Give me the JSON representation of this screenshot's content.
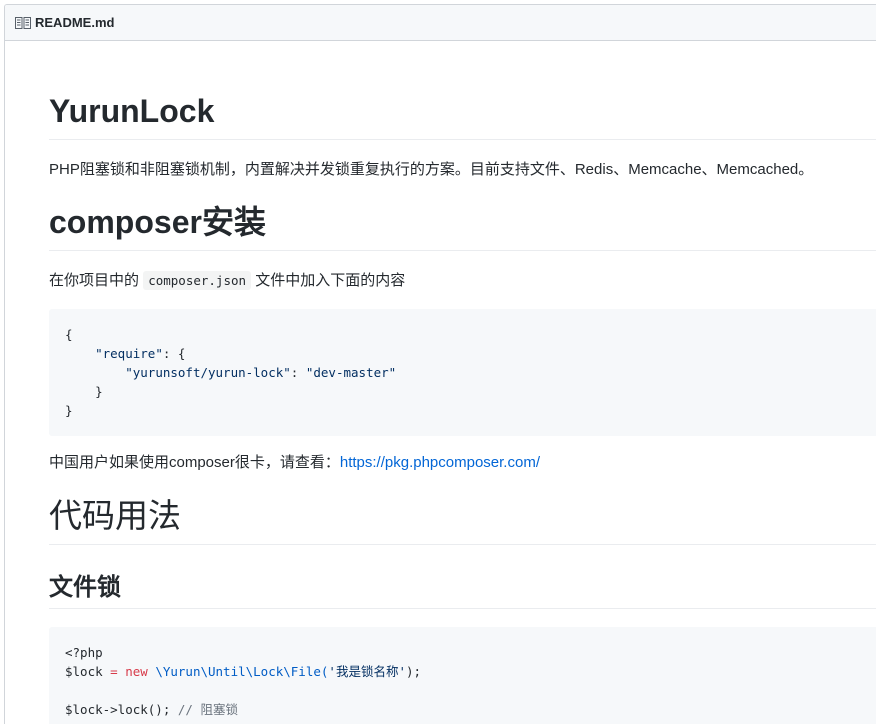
{
  "file_header": {
    "title": "README.md",
    "icon": "book-icon"
  },
  "readme": {
    "h1_title": "YurunLock",
    "description": "PHP阻塞锁和非阻塞锁机制，内置解决并发锁重复执行的方案。目前支持文件、Redis、Memcache、Memcached。",
    "h1_install": "composer安装",
    "install_prefix": "在你项目中的",
    "install_code": "composer.json",
    "install_suffix": "文件中加入下面的内容",
    "json_block": {
      "line1": "{",
      "line2_indent": "    ",
      "line2_key": "\"require\"",
      "line2_rest": ": {",
      "line3_indent": "        ",
      "line3_key": "\"yurunsoft/yurun-lock\"",
      "line3_sep": ": ",
      "line3_val": "\"dev-master\"",
      "line4": "    }",
      "line5": "}"
    },
    "cn_users_text": "中国用户如果使用composer很卡，请查看：",
    "cn_users_link": "https://pkg.phpcomposer.com/",
    "h1_usage": "代码用法",
    "h2_file_lock": "文件锁",
    "php_block": {
      "open_tag": "<?php",
      "var": "$lock",
      "eq": " = ",
      "kw_new": "new",
      "class": " \\Yurun\\Until\\Lock\\File(",
      "str": "'我是锁名称'",
      "end": ");",
      "line3": "$lock->lock(); ",
      "line3_comment": "// 阻塞锁"
    }
  }
}
